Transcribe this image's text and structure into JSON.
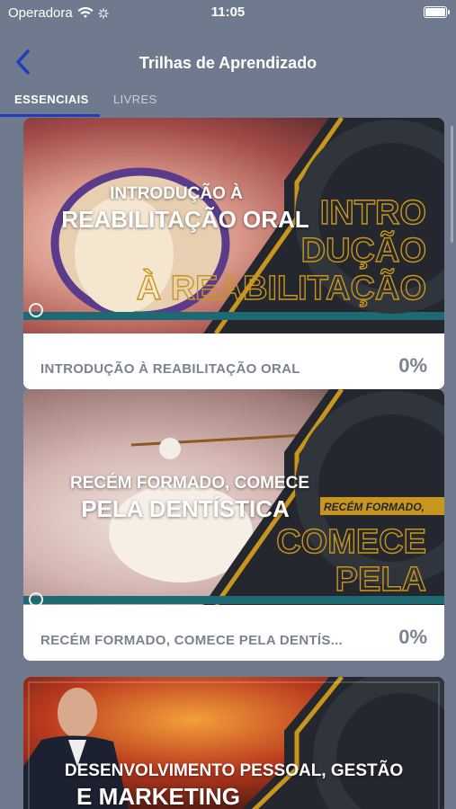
{
  "status_bar": {
    "carrier": "Operadora",
    "time": "11:05"
  },
  "nav": {
    "title": "Trilhas de Aprendizado"
  },
  "tabs": [
    {
      "label": "ESSENCIAIS",
      "active": true
    },
    {
      "label": "LIVRES",
      "active": false
    }
  ],
  "cards": [
    {
      "banner_line1": "INTRODUÇÃO À",
      "banner_line2": "REABILITAÇÃO ORAL",
      "label": "INTRODUÇÃO À REABILITAÇÃO ORAL",
      "progress": "0%"
    },
    {
      "banner_line1": "RECÉM FORMADO, COMECE",
      "banner_line2": "PELA DENTÍSTICA",
      "label": "RECÉM FORMADO, COMECE PELA DENTÍS...",
      "progress": "0%"
    },
    {
      "banner_line1": "DESENVOLVIMENTO PESSOAL, GESTÃO",
      "banner_line2": "E MARKETING"
    }
  ],
  "colors": {
    "accent": "#1f3bbf",
    "gold": "#c8961e",
    "teal": "#1e6a73"
  }
}
